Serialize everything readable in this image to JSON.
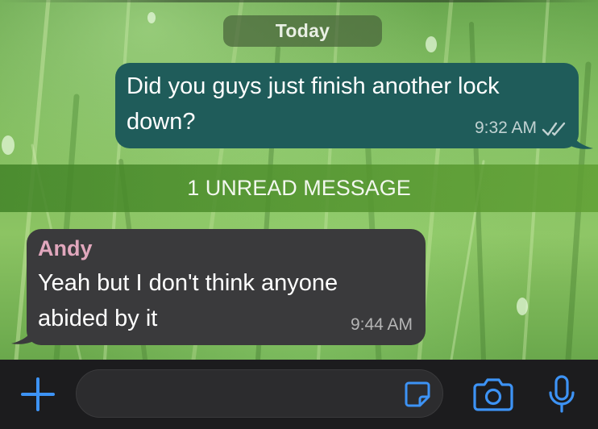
{
  "chat": {
    "date_separator": "Today",
    "unread_banner": "1 UNREAD MESSAGE",
    "messages": [
      {
        "direction": "outgoing",
        "text": "Did you guys just finish another lock\ndown?",
        "time": "9:32 AM",
        "status_icon": "double-check-icon"
      },
      {
        "direction": "incoming",
        "sender": "Andy",
        "text": "Yeah but I don't think anyone\nabided by it",
        "time": "9:44 AM"
      }
    ]
  },
  "input_bar": {
    "placeholder": "",
    "icons": [
      "plus-icon",
      "sticker-icon",
      "camera-icon",
      "microphone-icon"
    ]
  },
  "colors": {
    "outgoing_bubble": "#1f5c5a",
    "incoming_bubble": "#3a3a3c",
    "sender_name": "#e1a7bd",
    "accent_blue": "#3d93f5",
    "unread_bar": "#52923a",
    "input_bar_bg": "#1c1c1e"
  }
}
